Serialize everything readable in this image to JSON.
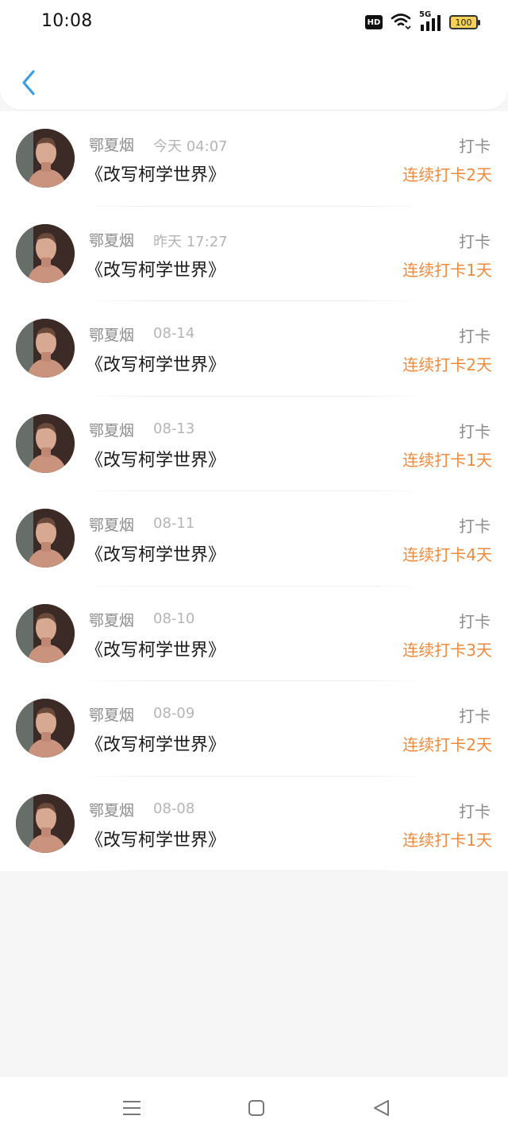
{
  "status_bar": {
    "time": "10:08",
    "hd": "HD",
    "network": "5G",
    "battery": "100"
  },
  "header": {
    "back_icon": "chevron-left-icon"
  },
  "records": [
    {
      "name": "鄂夏烟",
      "time": "今天 04:07",
      "title": "《改写柯学世界》",
      "action": "打卡",
      "streak": "连续打卡2天"
    },
    {
      "name": "鄂夏烟",
      "time": "昨天 17:27",
      "title": "《改写柯学世界》",
      "action": "打卡",
      "streak": "连续打卡1天"
    },
    {
      "name": "鄂夏烟",
      "time": "08-14",
      "title": "《改写柯学世界》",
      "action": "打卡",
      "streak": "连续打卡2天"
    },
    {
      "name": "鄂夏烟",
      "time": "08-13",
      "title": "《改写柯学世界》",
      "action": "打卡",
      "streak": "连续打卡1天"
    },
    {
      "name": "鄂夏烟",
      "time": "08-11",
      "title": "《改写柯学世界》",
      "action": "打卡",
      "streak": "连续打卡4天"
    },
    {
      "name": "鄂夏烟",
      "time": "08-10",
      "title": "《改写柯学世界》",
      "action": "打卡",
      "streak": "连续打卡3天"
    },
    {
      "name": "鄂夏烟",
      "time": "08-09",
      "title": "《改写柯学世界》",
      "action": "打卡",
      "streak": "连续打卡2天"
    },
    {
      "name": "鄂夏烟",
      "time": "08-08",
      "title": "《改写柯学世界》",
      "action": "打卡",
      "streak": "连续打卡1天"
    }
  ],
  "nav": {
    "menu_icon": "menu-icon",
    "home_icon": "home-square-icon",
    "back_icon": "back-triangle-icon"
  },
  "colors": {
    "accent_blue": "#3a9ee4",
    "streak_orange": "#ec8a3d",
    "background": "#f7f6f6"
  }
}
